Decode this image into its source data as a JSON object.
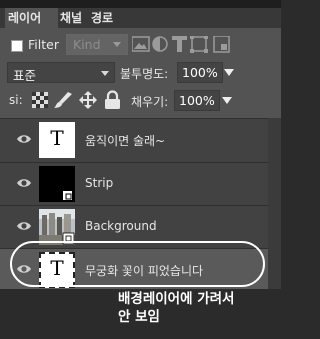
{
  "tabs": [
    "레이어",
    "채널",
    "경로"
  ],
  "filter": {
    "label": "Filter",
    "kind_value": "Kind"
  },
  "filter_icons": [
    "image-icon",
    "adjustment-icon",
    "type-icon",
    "shape-icon",
    "smart-object-icon"
  ],
  "blend": {
    "mode": "표준",
    "opacity_label": "불투명도:",
    "opacity_value": "100%"
  },
  "lock": {
    "label": "si:",
    "fill_label": "채우기:",
    "fill_value": "100%"
  },
  "lock_icons": [
    "lock-transparent-icon",
    "lock-paint-icon",
    "lock-move-icon",
    "lock-all-icon"
  ],
  "layers": [
    {
      "name": "움직이면 술래~",
      "thumb": "T",
      "type": "text"
    },
    {
      "name": "Strip",
      "thumb": "",
      "type": "smart"
    },
    {
      "name": "Background",
      "thumb": "",
      "type": "photo"
    },
    {
      "name": "무궁화 꽃이 피었습니다",
      "thumb": "T",
      "type": "text",
      "selected": true
    }
  ],
  "annotation": {
    "line1": "배경레이어에 가려서",
    "line2": "안 보임"
  },
  "colors": {
    "panel": "#535353",
    "layers_bg": "#424242",
    "selected": "#5a5a5a",
    "bottom": "#2b2b2b"
  }
}
